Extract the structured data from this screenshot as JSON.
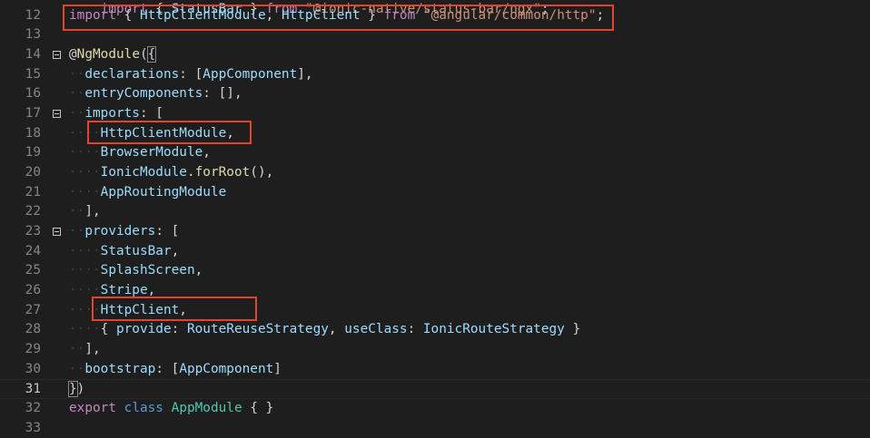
{
  "editor": {
    "active_line": "31",
    "lines": [
      {
        "num": "12",
        "fold": false,
        "tokens": [
          {
            "t": "import",
            "c": "kw"
          },
          {
            "t": " { ",
            "c": "pun"
          },
          {
            "t": "HttpClientModule",
            "c": "var"
          },
          {
            "t": ", ",
            "c": "pun"
          },
          {
            "t": "HttpClient",
            "c": "var"
          },
          {
            "t": " } ",
            "c": "pun"
          },
          {
            "t": "from",
            "c": "kw"
          },
          {
            "t": " ",
            "c": "pun"
          },
          {
            "t": "\"@angular/common/http\"",
            "c": "str"
          },
          {
            "t": ";",
            "c": "pun"
          }
        ]
      },
      {
        "num": "13",
        "fold": false,
        "tokens": []
      },
      {
        "num": "14",
        "fold": true,
        "tokens": [
          {
            "t": "@",
            "c": "pun"
          },
          {
            "t": "NgModule",
            "c": "dec"
          },
          {
            "t": "(",
            "c": "pun"
          },
          {
            "t": "{",
            "c": "pun"
          }
        ]
      },
      {
        "num": "15",
        "fold": false,
        "tokens": [
          {
            "t": "··",
            "c": "ws"
          },
          {
            "t": "declarations",
            "c": "var"
          },
          {
            "t": ": [",
            "c": "pun"
          },
          {
            "t": "AppComponent",
            "c": "var"
          },
          {
            "t": "],",
            "c": "pun"
          }
        ]
      },
      {
        "num": "16",
        "fold": false,
        "tokens": [
          {
            "t": "··",
            "c": "ws"
          },
          {
            "t": "entryComponents",
            "c": "var"
          },
          {
            "t": ": [],",
            "c": "pun"
          }
        ]
      },
      {
        "num": "17",
        "fold": true,
        "tokens": [
          {
            "t": "··",
            "c": "ws"
          },
          {
            "t": "imports",
            "c": "var"
          },
          {
            "t": ": [",
            "c": "pun"
          }
        ]
      },
      {
        "num": "18",
        "fold": false,
        "tokens": [
          {
            "t": "····",
            "c": "ws"
          },
          {
            "t": "HttpClientModule",
            "c": "var"
          },
          {
            "t": ",",
            "c": "pun"
          }
        ]
      },
      {
        "num": "19",
        "fold": false,
        "tokens": [
          {
            "t": "····",
            "c": "ws"
          },
          {
            "t": "BrowserModule",
            "c": "var"
          },
          {
            "t": ",",
            "c": "pun"
          }
        ]
      },
      {
        "num": "20",
        "fold": false,
        "tokens": [
          {
            "t": "····",
            "c": "ws"
          },
          {
            "t": "IonicModule",
            "c": "var"
          },
          {
            "t": ".",
            "c": "pun"
          },
          {
            "t": "forRoot",
            "c": "fn"
          },
          {
            "t": "(),",
            "c": "pun"
          }
        ]
      },
      {
        "num": "21",
        "fold": false,
        "tokens": [
          {
            "t": "····",
            "c": "ws"
          },
          {
            "t": "AppRoutingModule",
            "c": "var"
          }
        ]
      },
      {
        "num": "22",
        "fold": false,
        "tokens": [
          {
            "t": "··",
            "c": "ws"
          },
          {
            "t": "],",
            "c": "pun"
          }
        ]
      },
      {
        "num": "23",
        "fold": true,
        "tokens": [
          {
            "t": "··",
            "c": "ws"
          },
          {
            "t": "providers",
            "c": "var"
          },
          {
            "t": ": [",
            "c": "pun"
          }
        ]
      },
      {
        "num": "24",
        "fold": false,
        "tokens": [
          {
            "t": "····",
            "c": "ws"
          },
          {
            "t": "StatusBar",
            "c": "var"
          },
          {
            "t": ",",
            "c": "pun"
          }
        ]
      },
      {
        "num": "25",
        "fold": false,
        "tokens": [
          {
            "t": "····",
            "c": "ws"
          },
          {
            "t": "SplashScreen",
            "c": "var"
          },
          {
            "t": ",",
            "c": "pun"
          }
        ]
      },
      {
        "num": "26",
        "fold": false,
        "tokens": [
          {
            "t": "····",
            "c": "ws"
          },
          {
            "t": "Stripe",
            "c": "var"
          },
          {
            "t": ",",
            "c": "pun"
          }
        ]
      },
      {
        "num": "27",
        "fold": false,
        "tokens": [
          {
            "t": "····",
            "c": "ws"
          },
          {
            "t": "HttpClient",
            "c": "var"
          },
          {
            "t": ",",
            "c": "pun"
          }
        ]
      },
      {
        "num": "28",
        "fold": false,
        "tokens": [
          {
            "t": "····",
            "c": "ws"
          },
          {
            "t": "{ ",
            "c": "pun"
          },
          {
            "t": "provide",
            "c": "var"
          },
          {
            "t": ": ",
            "c": "pun"
          },
          {
            "t": "RouteReuseStrategy",
            "c": "var"
          },
          {
            "t": ", ",
            "c": "pun"
          },
          {
            "t": "useClass",
            "c": "var"
          },
          {
            "t": ": ",
            "c": "pun"
          },
          {
            "t": "IonicRouteStrategy",
            "c": "var"
          },
          {
            "t": " }",
            "c": "pun"
          }
        ]
      },
      {
        "num": "29",
        "fold": false,
        "tokens": [
          {
            "t": "··",
            "c": "ws"
          },
          {
            "t": "],",
            "c": "pun"
          }
        ]
      },
      {
        "num": "30",
        "fold": false,
        "tokens": [
          {
            "t": "··",
            "c": "ws"
          },
          {
            "t": "bootstrap",
            "c": "var"
          },
          {
            "t": ": [",
            "c": "pun"
          },
          {
            "t": "AppComponent",
            "c": "var"
          },
          {
            "t": "]",
            "c": "pun"
          }
        ]
      },
      {
        "num": "31",
        "fold": false,
        "tokens": [
          {
            "t": "}",
            "c": "pun"
          },
          {
            "t": ")",
            "c": "pun"
          }
        ]
      },
      {
        "num": "32",
        "fold": false,
        "tokens": [
          {
            "t": "export",
            "c": "kw"
          },
          {
            "t": " ",
            "c": "pun"
          },
          {
            "t": "class",
            "c": "kwb"
          },
          {
            "t": " ",
            "c": "pun"
          },
          {
            "t": "AppModule",
            "c": "ty"
          },
          {
            "t": " { }",
            "c": "pun"
          }
        ]
      },
      {
        "num": "33",
        "fold": false,
        "tokens": []
      }
    ]
  }
}
